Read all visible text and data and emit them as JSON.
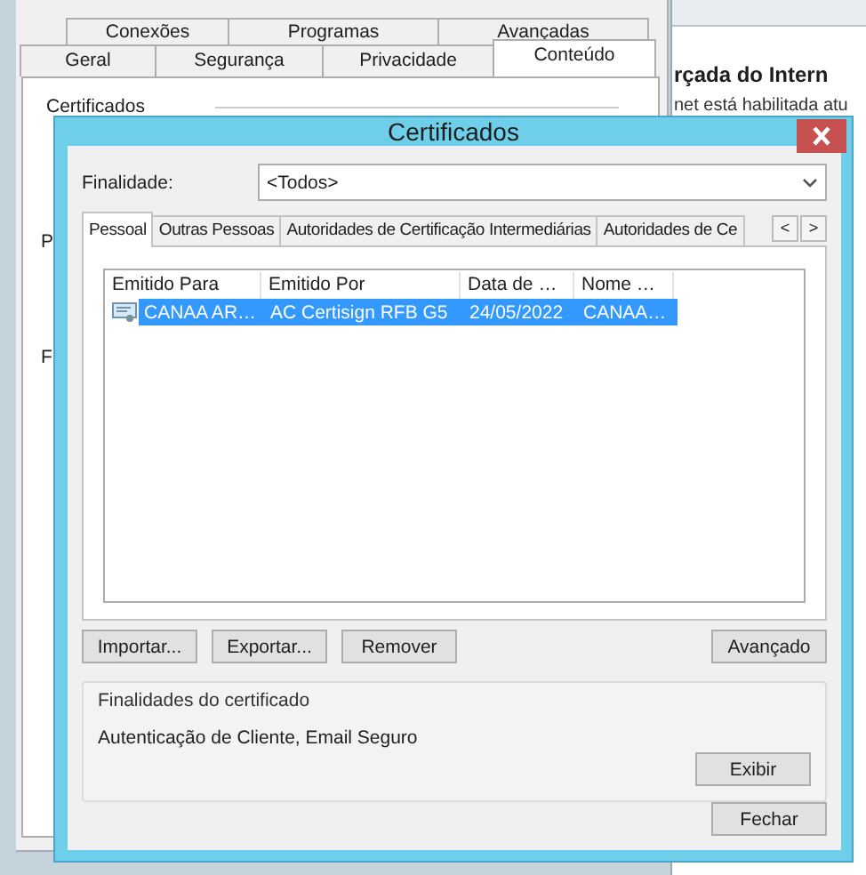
{
  "internet_options": {
    "tabs_row_1": [
      {
        "label": "Conexões",
        "selected": false
      },
      {
        "label": "Programas",
        "selected": false
      },
      {
        "label": "Avançadas",
        "selected": false
      }
    ],
    "tabs_row_2": [
      {
        "label": "Geral",
        "selected": false
      },
      {
        "label": "Segurança",
        "selected": false
      },
      {
        "label": "Privacidade",
        "selected": false
      },
      {
        "label": "Conteúdo",
        "selected": true
      }
    ],
    "group_label": "Certificados",
    "cut_labels": [
      "P",
      "F"
    ]
  },
  "web_page": {
    "heading": "rçada do Intern",
    "text": "net está habilitada atu"
  },
  "dialog": {
    "title": "Certificados",
    "purpose_label": "Finalidade:",
    "purpose_value": "<Todos>",
    "tabs": [
      {
        "label": "Pessoal",
        "selected": true
      },
      {
        "label": "Outras Pessoas",
        "selected": false
      },
      {
        "label": "Autoridades de Certificação Intermediárias",
        "selected": false
      },
      {
        "label": "Autoridades de Ce",
        "selected": false
      }
    ],
    "tab_scroll": [
      "<",
      ">"
    ],
    "columns": [
      "Emitido Para",
      "Emitido Por",
      "Data de …",
      "Nome …"
    ],
    "rows": [
      {
        "cells": [
          "CANAA AR…",
          "AC Certisign RFB G5",
          "24/05/2022",
          "CANAA…"
        ],
        "selected": true
      }
    ],
    "buttons": [
      "Importar...",
      "Exportar...",
      "Remover"
    ],
    "advanced_button": "Avançado",
    "purposes_group": {
      "title": "Finalidades do certificado",
      "text": "Autenticação de Cliente, Email Seguro",
      "button": "Exibir"
    },
    "close_button": "Fechar"
  }
}
